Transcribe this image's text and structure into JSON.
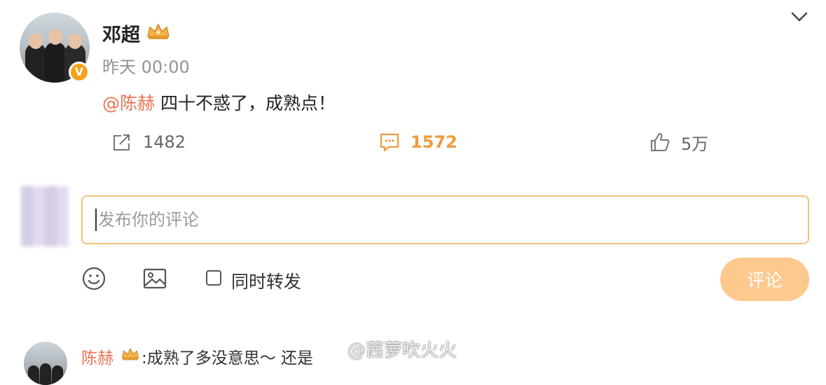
{
  "post": {
    "author": "邓超",
    "time": "昨天 00:00",
    "mention": "@陈赫",
    "text": " 四十不惑了，成熟点！",
    "stats": {
      "repost": "1482",
      "comment": "1572",
      "like": "5万"
    },
    "icons": {
      "repost": "share-icon",
      "comment": "comment-icon",
      "like": "thumbs-up-icon",
      "menu": "chevron-down-icon",
      "badge": "verified-v-badge",
      "crown": "crown-icon"
    }
  },
  "comment_box": {
    "placeholder": "发布你的评论",
    "repost_label": "同时转发",
    "submit_label": "评论",
    "icons": {
      "emoji": "emoji-icon",
      "image": "image-icon"
    }
  },
  "reply": {
    "author": "陈赫",
    "text": ":成熟了多没意思～ 还是",
    "watermark": "@茜萝吹火火"
  },
  "colors": {
    "accent_orange": "#f09a3e",
    "mention": "#eb7350",
    "input_border": "#f0c27a",
    "submit_bg": "#fdc98d",
    "verified": "#f7a21a"
  }
}
